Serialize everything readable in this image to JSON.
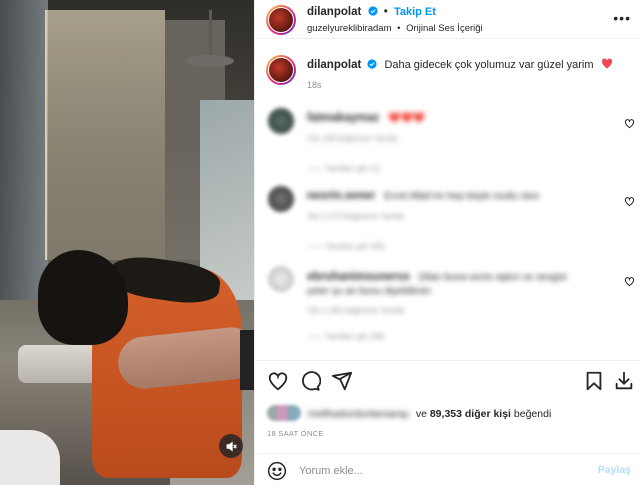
{
  "post": {
    "username": "dilanpolat",
    "follow_label": "Takip Et",
    "location": "guzelyureklibiradam",
    "audio": "Orijinal Ses İçeriği",
    "more_label": "•••"
  },
  "caption": {
    "username": "dilanpolat",
    "text": "Daha gidecek çok yolumuz var güzel yarim",
    "emoji": "❤️",
    "time": "18s"
  },
  "comments": [
    {
      "username": "fatmakaymaz",
      "text": "❤️❤️❤️",
      "meta": "13s   149 beğenme   Yanıtla",
      "replies": "——   Yanıtları gör (1)"
    },
    {
      "username": "nesrin.sener",
      "text": "Ervel Allah'ım hep böyle mutlu olun",
      "meta": "16s   1.073 beğenme   Yanıtla",
      "replies": "——   Yanıtları gör (43)"
    },
    {
      "username": "ebruhanimsunerss",
      "text": "Dilan buna senin aşkın ve sevgisi yeter şu an bunu diyebilirsin",
      "meta": "16s   1.185 beğenme   Yanıtla",
      "replies": "——   Yanıtları gör (48)"
    }
  ],
  "likes": {
    "names": "melihadurdunlarsaray",
    "text_and": "ve",
    "count": "89,353 diğer kişi",
    "liked": "beğendi"
  },
  "time_ago": "18 SAAT ÖNCE",
  "comment_input": {
    "placeholder": "Yorum ekle...",
    "post_label": "Paylaş"
  },
  "colors": {
    "accent": "#0095f6",
    "heart_red": "#ed4956",
    "post_disabled": "#b2dffc"
  },
  "icons": [
    "verified-badge-icon",
    "heart-icon",
    "comment-icon",
    "share-icon",
    "bookmark-icon",
    "download-icon",
    "emoji-icon",
    "mute-icon",
    "more-icon"
  ]
}
